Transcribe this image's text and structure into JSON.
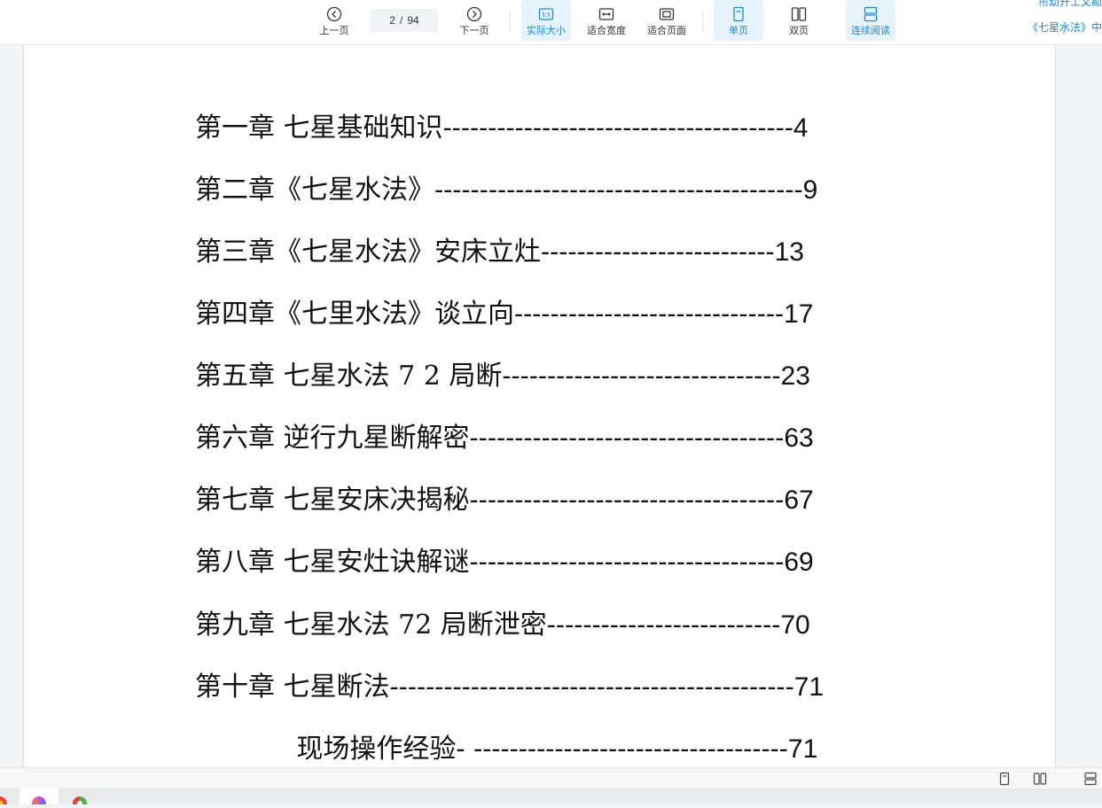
{
  "toolbar": {
    "prev_label": "上一页",
    "next_label": "下一页",
    "current_page": "2",
    "page_separator": "/",
    "total_pages": "94",
    "actual_size_label": "实际大小",
    "fit_width_label": "适合宽度",
    "fit_page_label": "适合页面",
    "single_page_label": "单页",
    "double_page_label": "双页",
    "continuous_label": "连续阅读",
    "active_color": "#1a8ad4",
    "side_title_top": "帘幼开工文勘",
    "side_title": "《七星水法》中"
  },
  "toc": [
    {
      "title": "第一章  七星基础知识",
      "leader": "---------------------------------------",
      "page": "4"
    },
    {
      "title": "第二章《七星水法》",
      "leader": "-----------------------------------------",
      "page": "9"
    },
    {
      "title": "第三章《七星水法》安床立灶",
      "leader": "--------------------------",
      "page": "13"
    },
    {
      "title": "第四章《七里水法》谈立向",
      "leader": "------------------------------",
      "page": "17"
    },
    {
      "title": "第五章  七星水法 7 2   局断",
      "leader": "-------------------------------",
      "page": "23"
    },
    {
      "title": "第六章  逆行九星断解密",
      "leader": "-----------------------------------",
      "page": "63"
    },
    {
      "title": "第七章  七星安床决揭秘",
      "leader": "-----------------------------------",
      "page": "67"
    },
    {
      "title": "第八章  七星安灶诀解谜",
      "leader": "-----------------------------------",
      "page": "69"
    },
    {
      "title": "第九章  七星水法 72 局断泄密",
      "leader": "--------------------------",
      "page": "70"
    },
    {
      "title": "第十章  七星断法",
      "leader": "---------------------------------------------",
      "page": "71"
    },
    {
      "title": "            现场操作经验- ",
      "leader": "-----------------------------------",
      "page": "71"
    }
  ]
}
